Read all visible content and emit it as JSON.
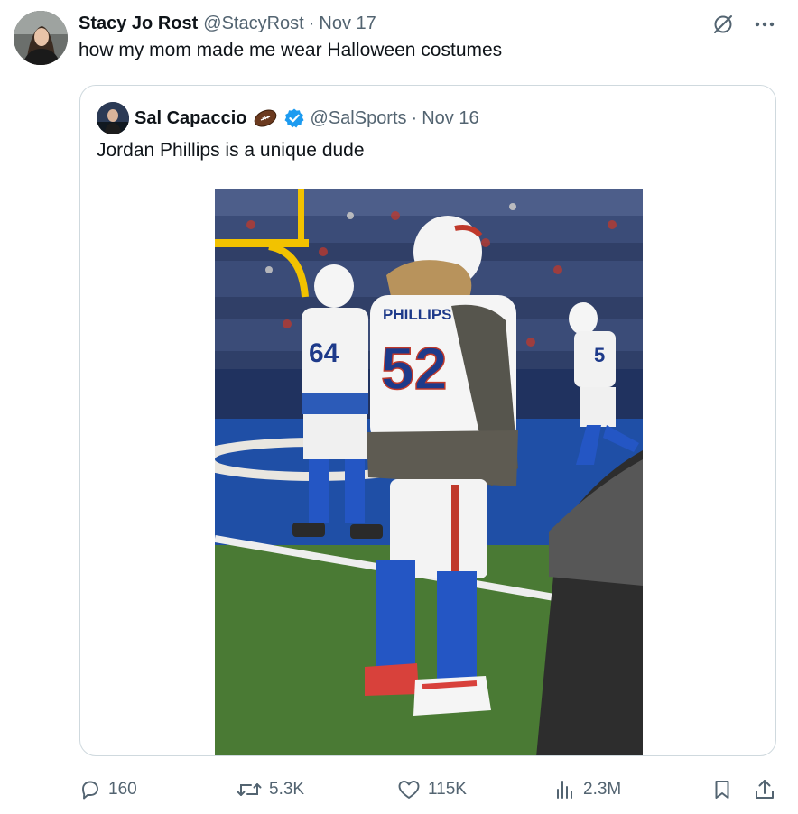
{
  "tweet": {
    "author_name": "Stacy Jo Rost",
    "author_handle": "@StacyRost",
    "separator": "·",
    "date": "Nov 17",
    "text": "how my mom made me wear Halloween costumes"
  },
  "quoted_tweet": {
    "author_name": "Sal Capaccio",
    "author_handle": "@SalSports",
    "separator": "·",
    "date": "Nov 16",
    "text": "Jordan Phillips is a unique dude",
    "verified": true,
    "name_emoji_icon": "football-icon",
    "photo": {
      "jersey_name": "PHILLIPS",
      "jersey_number": "52",
      "player_left_number": "64",
      "player_right_number": "5"
    }
  },
  "actions": {
    "replies": "160",
    "reposts": "5.3K",
    "likes": "115K",
    "views": "2.3M"
  },
  "icons": {
    "replies": "reply-icon",
    "reposts": "repost-icon",
    "likes": "heart-icon",
    "views": "views-icon",
    "bookmark": "bookmark-icon",
    "share": "share-icon",
    "grok": "grok-icon",
    "more": "more-icon"
  },
  "colors": {
    "text_primary": "#0f1419",
    "text_secondary": "#536471",
    "border": "#cfd9de",
    "verified": "#1d9bf0"
  }
}
